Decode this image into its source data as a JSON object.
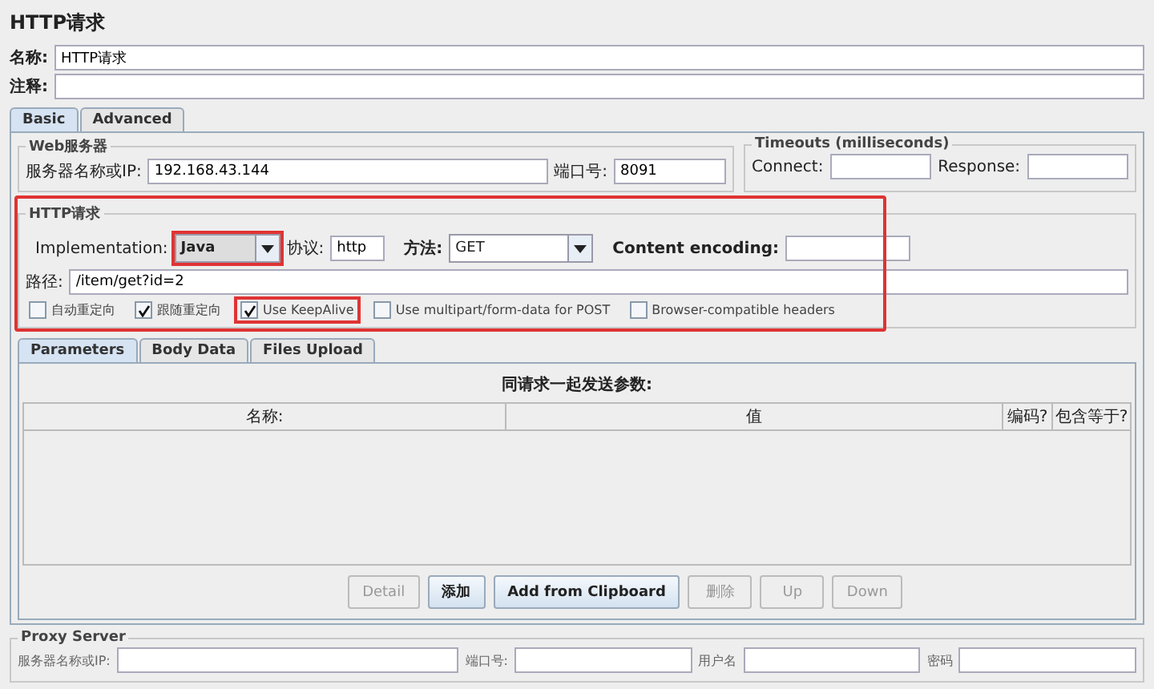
{
  "window": {
    "title": "HTTP请求"
  },
  "name_field": {
    "label": "名称:",
    "value": "HTTP请求"
  },
  "comment_field": {
    "label": "注释:"
  },
  "tabs": [
    {
      "label": "Basic",
      "selected": true
    },
    {
      "label": "Advanced",
      "selected": false
    }
  ],
  "web_server": {
    "title": "Web服务器",
    "host_label": "服务器名称或IP:",
    "host": "192.168.43.144",
    "port_label": "端口号:",
    "port": "8091"
  },
  "timeouts": {
    "title": "Timeouts (milliseconds)",
    "connect_label": "Connect:",
    "response_label": "Response:"
  },
  "http_request": {
    "title": "HTTP请求",
    "highlighted": true,
    "implementation": {
      "label": "Implementation:",
      "value": "Java",
      "highlighted": true
    },
    "protocol": {
      "label": "协议:",
      "value": "http"
    },
    "method": {
      "label": "方法:",
      "value": "GET"
    },
    "encoding": {
      "label": "Content encoding:"
    },
    "path": {
      "label": "路径:",
      "value": "/item/get?id=2"
    },
    "options": [
      {
        "label": "自动重定向",
        "checked": false,
        "highlighted": false
      },
      {
        "label": "跟随重定向",
        "checked": true,
        "highlighted": false
      },
      {
        "label": "Use KeepAlive",
        "checked": true,
        "highlighted": true
      },
      {
        "label": "Use multipart/form-data for POST",
        "checked": false,
        "highlighted": false
      },
      {
        "label": "Browser-compatible headers",
        "checked": false,
        "highlighted": false
      }
    ]
  },
  "sub_tabs": [
    {
      "label": "Parameters",
      "selected": true
    },
    {
      "label": "Body Data",
      "selected": false
    },
    {
      "label": "Files Upload",
      "selected": false
    }
  ],
  "parameters": {
    "title": "同请求一起发送参数:",
    "columns": [
      "名称:",
      "值",
      "编码?",
      "包含等于?"
    ]
  },
  "buttons": [
    {
      "label": "Detail",
      "disabled": true
    },
    {
      "label": "添加",
      "disabled": false
    },
    {
      "label": "Add from Clipboard",
      "disabled": false
    },
    {
      "label": "删除",
      "disabled": true
    },
    {
      "label": "Up",
      "disabled": true
    },
    {
      "label": "Down",
      "disabled": true
    }
  ],
  "proxy": {
    "title": "Proxy Server",
    "host_label": "服务器名称或IP:",
    "port_label": "端口号:",
    "user_label": "用户名",
    "password_label": "密码"
  }
}
